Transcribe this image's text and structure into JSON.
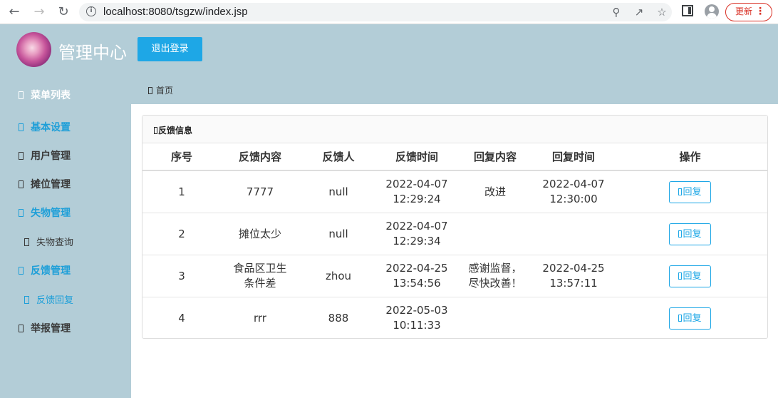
{
  "browser": {
    "url": "localhost:8080/tsgzw/index.jsp",
    "update_label": "更新"
  },
  "header": {
    "title": "管理中心",
    "logout_label": "退出登录"
  },
  "sidebar": {
    "menu_header": "菜单列表",
    "items": [
      {
        "label": "基本设置"
      },
      {
        "label": "用户管理"
      },
      {
        "label": "摊位管理"
      },
      {
        "label": "失物管理"
      },
      {
        "label": "失物查询"
      },
      {
        "label": "反馈管理"
      },
      {
        "label": "反馈回复"
      },
      {
        "label": "举报管理"
      }
    ]
  },
  "breadcrumb": {
    "home": "首页"
  },
  "panel": {
    "title": "反馈信息",
    "columns": [
      "序号",
      "反馈内容",
      "反馈人",
      "反馈时间",
      "回复内容",
      "回复时间",
      "操作"
    ],
    "rows": [
      {
        "no": "1",
        "content": "7777",
        "user": "null",
        "time": "2022-04-07\n12:29:24",
        "reply": "改进",
        "reply_time": "2022-04-07\n12:30:00",
        "action": "回复"
      },
      {
        "no": "2",
        "content": "摊位太少",
        "user": "null",
        "time": "2022-04-07\n12:29:34",
        "reply": "",
        "reply_time": "",
        "action": "回复"
      },
      {
        "no": "3",
        "content": "食品区卫生\n条件差",
        "user": "zhou",
        "time": "2022-04-25\n13:54:56",
        "reply": "感谢监督，\n尽快改善！",
        "reply_time": "2022-04-25\n13:57:11",
        "action": "回复"
      },
      {
        "no": "4",
        "content": "rrr",
        "user": "888",
        "time": "2022-05-03\n10:11:33",
        "reply": "",
        "reply_time": "",
        "action": "回复"
      }
    ]
  },
  "colors": {
    "sidebar_bg": "#b3cdd7",
    "accent": "#1ea7e6",
    "update_red": "#d93025"
  }
}
